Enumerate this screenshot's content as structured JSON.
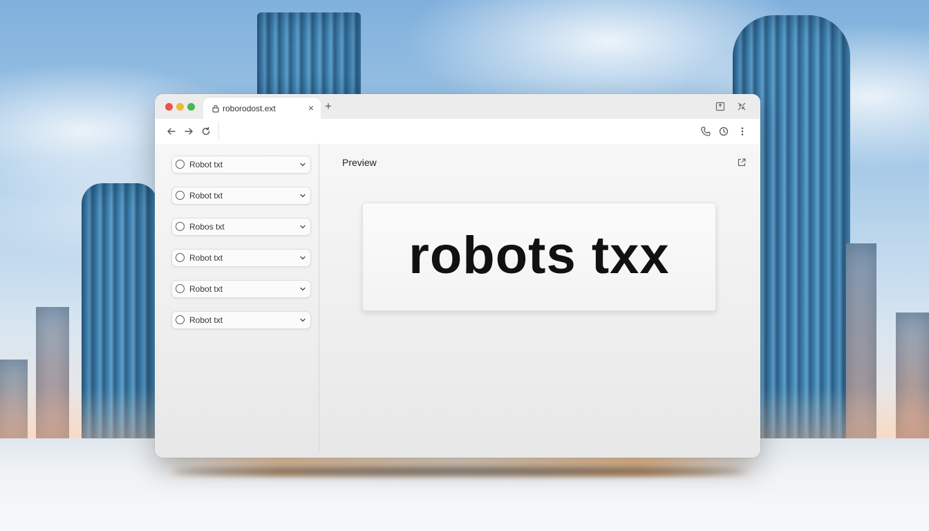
{
  "tab": {
    "title": "roborodost.ext",
    "close_glyph": "×",
    "new_tab_glyph": "+"
  },
  "sidebar": {
    "items": [
      {
        "label": "Robot txt"
      },
      {
        "label": "Robot txt"
      },
      {
        "label": "Robos txt"
      },
      {
        "label": "Robot txt"
      },
      {
        "label": "Robot txt"
      },
      {
        "label": "Robot txt"
      }
    ]
  },
  "main": {
    "preview_label": "Preview",
    "preview_text": "robots txx"
  },
  "icons": {
    "traffic_lights": [
      "red-close-icon",
      "yellow-minimize-icon",
      "green-maximize-icon"
    ],
    "tab": "lock-icon",
    "titlebar_right": [
      "extension-box-icon",
      "shrink-icon"
    ],
    "toolbar_left": [
      "back-arrow-icon",
      "forward-arrow-icon",
      "reload-icon"
    ],
    "toolbar_right": [
      "phone-icon",
      "clock-icon",
      "kebab-menu-icon"
    ],
    "sidebar_item": [
      "radio-icon",
      "chevron-down-icon"
    ],
    "main": [
      "open-external-icon"
    ]
  },
  "colors": {
    "close": "#e8534a",
    "minimize": "#f2b631",
    "maximize": "#46b94a"
  }
}
